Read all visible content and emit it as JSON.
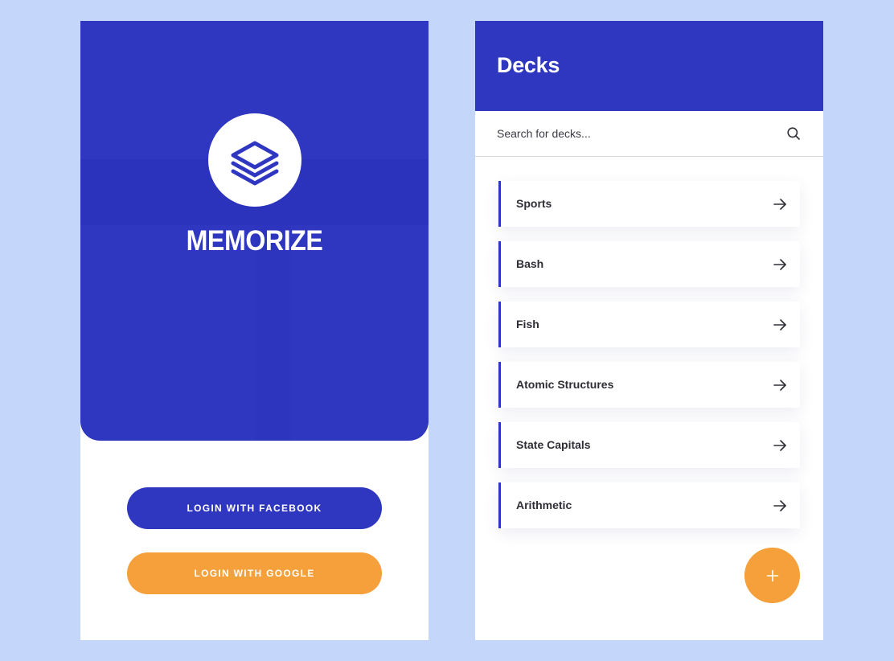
{
  "colors": {
    "background": "#c5d6fb",
    "brand_blue": "#2f37c1",
    "accent_orange": "#f5a03a"
  },
  "login": {
    "logo_icon": "layers-icon",
    "brand_name": "MEMORIZE",
    "facebook_button": "LOGIN WITH FACEBOOK",
    "google_button": "LOGIN WITH GOOGLE"
  },
  "decks": {
    "title": "Decks",
    "search": {
      "placeholder": "Search for decks...",
      "value": "",
      "icon": "search-icon"
    },
    "items": [
      {
        "name": "Sports",
        "icon": "arrow-right-icon"
      },
      {
        "name": "Bash",
        "icon": "arrow-right-icon"
      },
      {
        "name": "Fish",
        "icon": "arrow-right-icon"
      },
      {
        "name": "Atomic Structures",
        "icon": "arrow-right-icon"
      },
      {
        "name": "State Capitals",
        "icon": "arrow-right-icon"
      },
      {
        "name": "Arithmetic",
        "icon": "arrow-right-icon"
      }
    ],
    "fab_icon": "plus-icon"
  }
}
